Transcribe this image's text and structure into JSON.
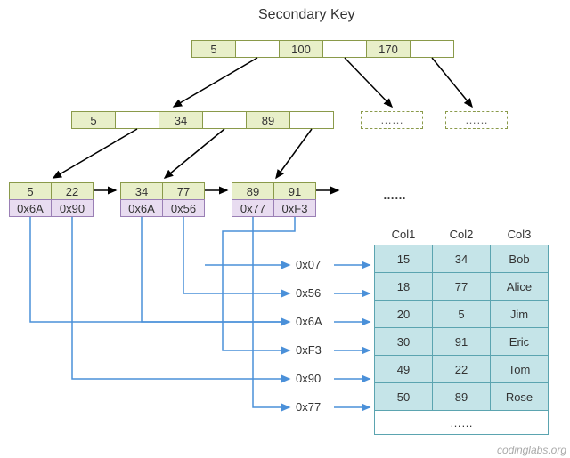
{
  "title": "Secondary Key",
  "root": {
    "v0": "5",
    "v1": "100",
    "v2": "170"
  },
  "mid": {
    "v0": "5",
    "v1": "34",
    "v2": "89"
  },
  "leaf1": {
    "k0": "5",
    "k1": "22",
    "a0": "0x6A",
    "a1": "0x90"
  },
  "leaf2": {
    "k0": "34",
    "k1": "77",
    "a0": "0x6A",
    "a1": "0x56"
  },
  "leaf3": {
    "k0": "89",
    "k1": "91",
    "a0": "0x77",
    "a1": "0xF3"
  },
  "ptr": [
    "0x07",
    "0x56",
    "0x6A",
    "0xF3",
    "0x90",
    "0x77"
  ],
  "table": {
    "headers": [
      "Col1",
      "Col2",
      "Col3"
    ],
    "rows": [
      [
        "15",
        "34",
        "Bob"
      ],
      [
        "18",
        "77",
        "Alice"
      ],
      [
        "20",
        "5",
        "Jim"
      ],
      [
        "30",
        "91",
        "Eric"
      ],
      [
        "49",
        "22",
        "Tom"
      ],
      [
        "50",
        "89",
        "Rose"
      ]
    ],
    "bottom": "……"
  },
  "dots": "……",
  "watermark": "codinglabs.org"
}
